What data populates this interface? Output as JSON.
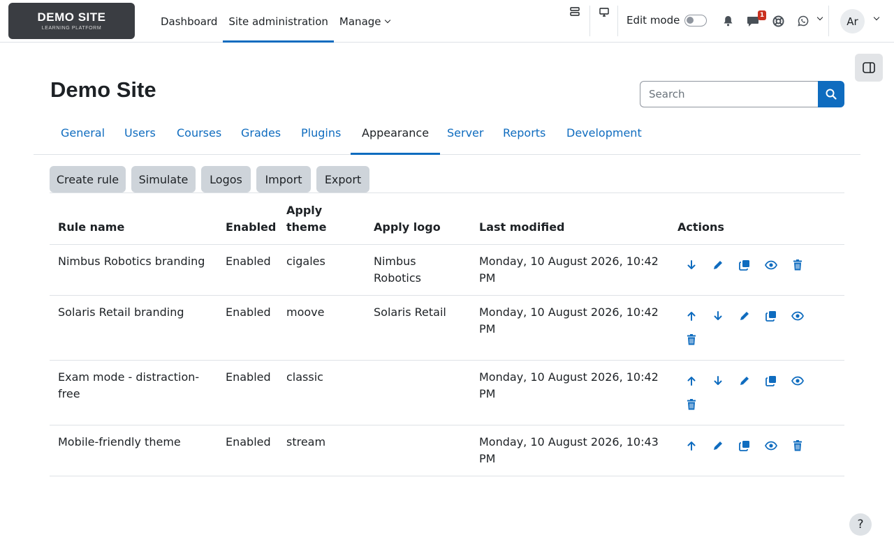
{
  "brand": {
    "name": "DEMO SITE",
    "tagline": "LEARNING PLATFORM"
  },
  "primary_nav": [
    "Dashboard",
    "Site administration",
    "Manage"
  ],
  "edit_mode_label": "Edit mode",
  "messages_count": "1",
  "avatar_initials": "Ar",
  "page_title": "Demo Site",
  "search": {
    "placeholder": "Search"
  },
  "tabs": [
    "General",
    "Users",
    "Courses",
    "Grades",
    "Plugins",
    "Appearance",
    "Server",
    "Reports",
    "Development"
  ],
  "active_tab": "Appearance",
  "buttons": [
    "Create rule",
    "Simulate",
    "Logos",
    "Import",
    "Export"
  ],
  "table": {
    "headers": {
      "rule_name": "Rule name",
      "enabled": "Enabled",
      "apply_theme_1": "Apply",
      "apply_theme_2": "theme",
      "apply_logo": "Apply logo",
      "last_modified": "Last modified",
      "actions": "Actions"
    },
    "rows": [
      {
        "name_1": "Nimbus Robotics branding",
        "name_2": "",
        "enabled": "Enabled",
        "theme": "cigales",
        "logo_1": "Nimbus",
        "logo_2": "Robotics",
        "modified_1": "Monday, 10 August 2026, 10:42",
        "modified_2": "PM"
      },
      {
        "name_1": "Solaris Retail branding",
        "name_2": "",
        "enabled": "Enabled",
        "theme": "moove",
        "logo_1": "Solaris Retail",
        "logo_2": "",
        "modified_1": "Monday, 10 August 2026, 10:42",
        "modified_2": "PM"
      },
      {
        "name_1": "Exam mode - distraction-",
        "name_2": "free",
        "enabled": "Enabled",
        "theme": "classic",
        "logo_1": "",
        "logo_2": "",
        "modified_1": "Monday, 10 August 2026, 10:42",
        "modified_2": "PM"
      },
      {
        "name_1": "Mobile-friendly theme",
        "name_2": "",
        "enabled": "Enabled",
        "theme": "stream",
        "logo_1": "",
        "logo_2": "",
        "modified_1": "Monday, 10 August 2026, 10:43",
        "modified_2": "PM"
      }
    ]
  },
  "help_label": "?",
  "colors": {
    "accent": "#0f6cbf",
    "badge": "#ca3120",
    "logo_bg": "#3a3d42"
  }
}
